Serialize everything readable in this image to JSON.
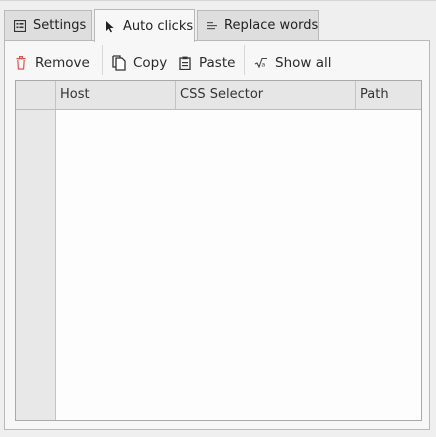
{
  "tabs": [
    {
      "label": "Settings",
      "icon": "settings-list-icon",
      "active": false
    },
    {
      "label": "Auto clicks",
      "icon": "cursor-icon",
      "active": true
    },
    {
      "label": "Replace words",
      "icon": "text-lines-icon",
      "active": false
    }
  ],
  "toolbar": {
    "remove_label": "Remove",
    "copy_label": "Copy",
    "paste_label": "Paste",
    "show_all_label": "Show all"
  },
  "table": {
    "columns": [
      "Host",
      "CSS Selector",
      "Path"
    ],
    "rows": []
  },
  "colors": {
    "remove_icon": "#d9534f",
    "background": "#efefef",
    "panel": "#f7f7f7"
  }
}
